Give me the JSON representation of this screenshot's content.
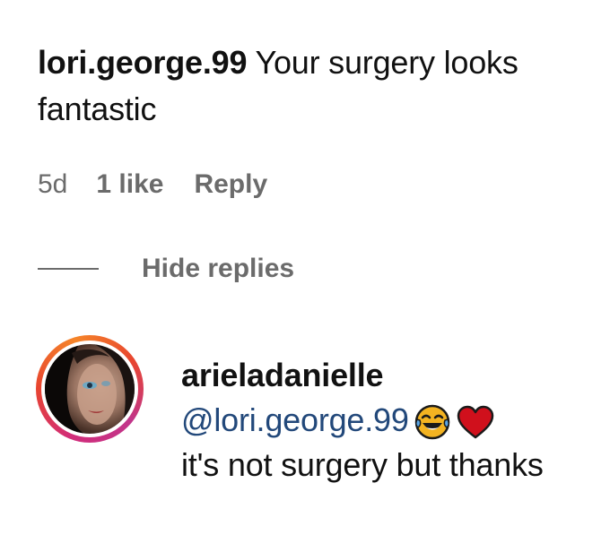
{
  "comment": {
    "username": "lori.george.99",
    "text": "Your surgery looks fantastic",
    "time": "5d",
    "likes": "1 like",
    "reply_label": "Reply"
  },
  "replies_toggle": {
    "label": "Hide replies"
  },
  "reply": {
    "username": "arieladanielle",
    "mention": "@lori.george.99",
    "emojis": [
      "tears-of-joy-emoji",
      "red-heart-emoji"
    ],
    "text": "it's not surgery but thanks"
  },
  "colors": {
    "text": "#111111",
    "muted": "#6b6b6b",
    "mention": "#22487a",
    "heart": "#d0101c"
  }
}
